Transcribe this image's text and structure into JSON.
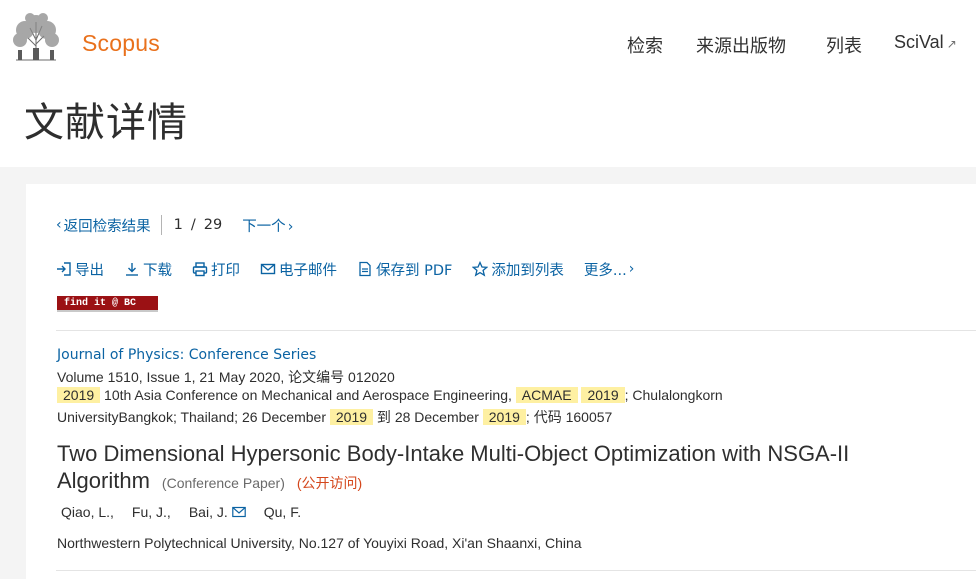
{
  "header": {
    "brand": "Scopus",
    "nav": {
      "search": "检索",
      "sources": "来源出版物",
      "lists": "列表",
      "scival": "SciVal",
      "scival_ext": "↗"
    },
    "page_title": "文献详情"
  },
  "result_nav": {
    "back": "返回检索结果",
    "current": "1",
    "slash": "/",
    "total": "29",
    "next": "下一个"
  },
  "tools": {
    "export": "导出",
    "download": "下载",
    "print": "打印",
    "email": "电子邮件",
    "save_pdf": "保存到 PDF",
    "add_list": "添加到列表",
    "more": "更多..."
  },
  "findit": "find it @ BC",
  "source": {
    "journal": "Journal of Physics: Conference Series",
    "volume_line": "Volume 1510, Issue 1, 21 May 2020, 论文编号 012020",
    "conf_year_1": "2019",
    "conf_name": " 10th Asia Conference on Mechanical and Aerospace Engineering, ",
    "conf_abbr": "ACMAE",
    "conf_year_2": "2019",
    "conf_loc": "; Chulalongkorn",
    "loc_line": "UniversityBangkok; Thailand; 26 December ",
    "date_year_1": "2019",
    "date_to": " 到 28 December ",
    "date_year_2": "2019",
    "code": "; 代码 160057"
  },
  "document": {
    "title": "Two Dimensional Hypersonic Body-Intake Multi-Object Optimization with NSGA-II Algorithm",
    "doc_type": "(Conference Paper)",
    "open_access": "(公开访问)"
  },
  "authors": [
    "Qiao, L.,",
    "Fu, J.,",
    "Bai, J.",
    "Qu, F."
  ],
  "affiliation": "Northwestern Polytechnical University, No.127 of Youyixi Road, Xi'an Shaanxi, China",
  "colors": {
    "brand": "#e9711c",
    "link": "#0b63a3",
    "highlight": "#fef0a2",
    "open_access": "#d4461b",
    "findit_bg": "#9b1114"
  }
}
